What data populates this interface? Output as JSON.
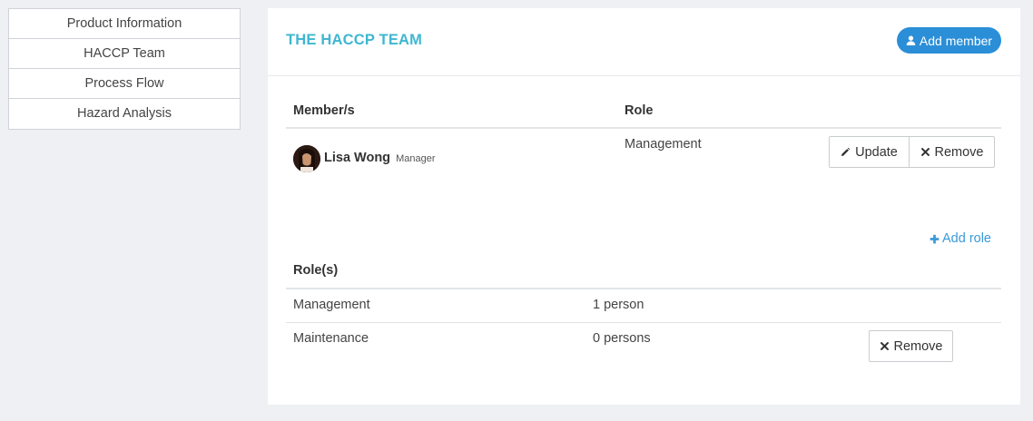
{
  "sidebar": {
    "items": [
      {
        "label": "Product Information"
      },
      {
        "label": "HACCP Team"
      },
      {
        "label": "Process Flow"
      },
      {
        "label": "Hazard Analysis"
      }
    ]
  },
  "panel": {
    "title": "THE HACCP TEAM",
    "add_member_label": "Add member"
  },
  "members": {
    "headers": {
      "member": "Member/s",
      "role": "Role"
    },
    "rows": [
      {
        "name": "Lisa Wong",
        "subtitle": "Manager",
        "role": "Management",
        "update_label": "Update",
        "remove_label": "Remove"
      }
    ]
  },
  "roles": {
    "add_role_label": "Add role",
    "header": "Role(s)",
    "rows": [
      {
        "name": "Management",
        "count": "1 person"
      },
      {
        "name": "Maintenance",
        "count": "0 persons",
        "remove_label": "Remove"
      }
    ]
  },
  "colors": {
    "accent": "#3fb7d1",
    "primary_button": "#2b8fd8",
    "link": "#3a9ad9",
    "background": "#eef0f4"
  },
  "icons": {
    "add_member": "user-icon",
    "update": "pencil-icon",
    "remove": "close-icon",
    "add_role": "plus-icon"
  }
}
